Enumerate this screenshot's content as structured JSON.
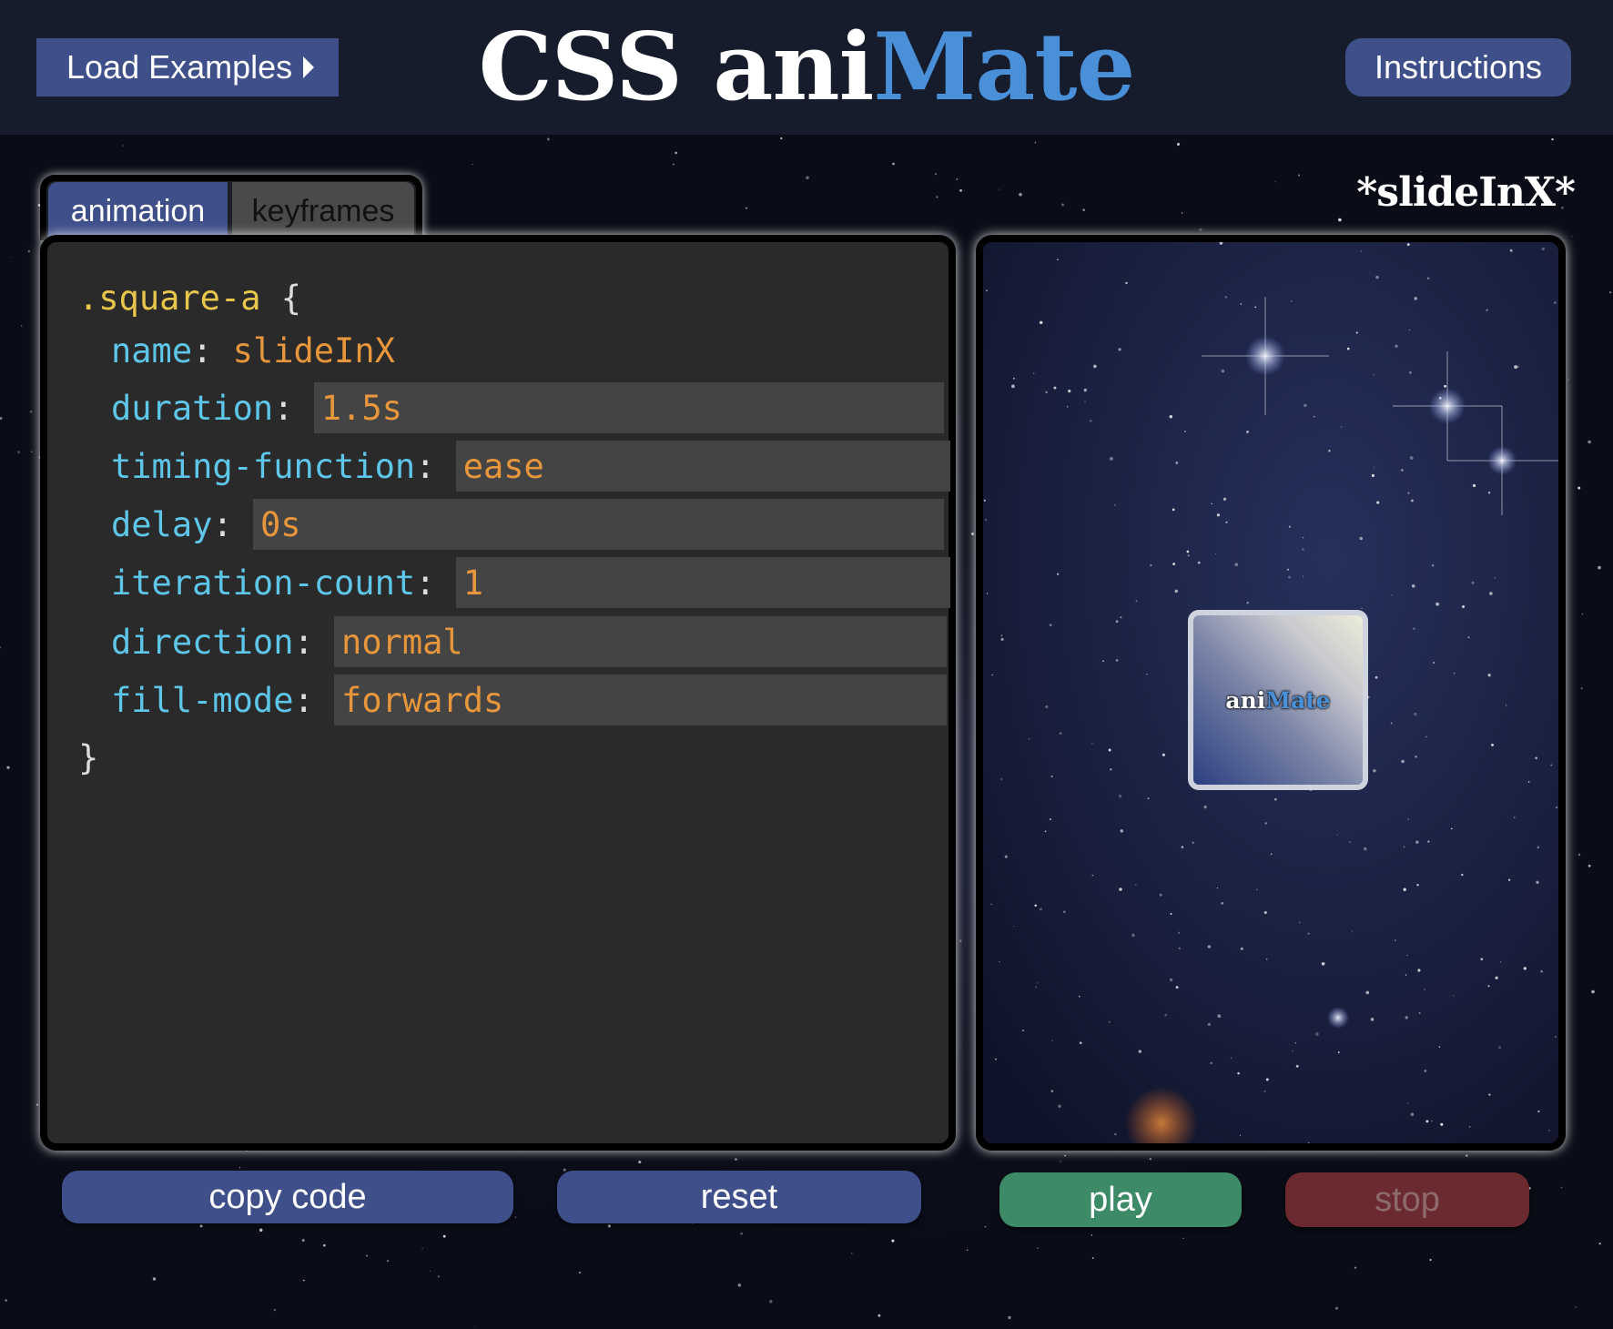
{
  "header": {
    "load_examples_label": "Load Examples",
    "logo_prefix": "CSS ani",
    "logo_suffix": "Mate",
    "instructions_label": "Instructions"
  },
  "tabs": [
    {
      "label": "animation",
      "active": true
    },
    {
      "label": "keyframes",
      "active": false
    }
  ],
  "code": {
    "selector": ".square-a",
    "open_brace": "{",
    "close_brace": "}",
    "properties": [
      {
        "name": "name",
        "value": "slideInX",
        "editable": false
      },
      {
        "name": "duration",
        "value": "1.5s",
        "editable": true
      },
      {
        "name": "timing-function",
        "value": "ease",
        "editable": true
      },
      {
        "name": "delay",
        "value": "0s",
        "editable": true
      },
      {
        "name": "iteration-count",
        "value": "1",
        "editable": true
      },
      {
        "name": "direction",
        "value": "normal",
        "editable": true
      },
      {
        "name": "fill-mode",
        "value": "forwards",
        "editable": true
      }
    ]
  },
  "preview": {
    "animation_title": "*slideInX*",
    "square_text_prefix": "ani",
    "square_text_suffix": "Mate"
  },
  "buttons": {
    "copy_code": "copy code",
    "reset": "reset",
    "play": "play",
    "stop": "stop"
  },
  "colors": {
    "header_bg": "#161c2b",
    "primary_button": "#3f4f8a",
    "play_button": "#3c8a66",
    "stop_button": "#6a2a2f",
    "logo_accent": "#4a90d9",
    "editor_bg": "#2a2a2a",
    "property_color": "#5ec6e8",
    "value_color": "#e8963c",
    "selector_color": "#e8c64c"
  }
}
